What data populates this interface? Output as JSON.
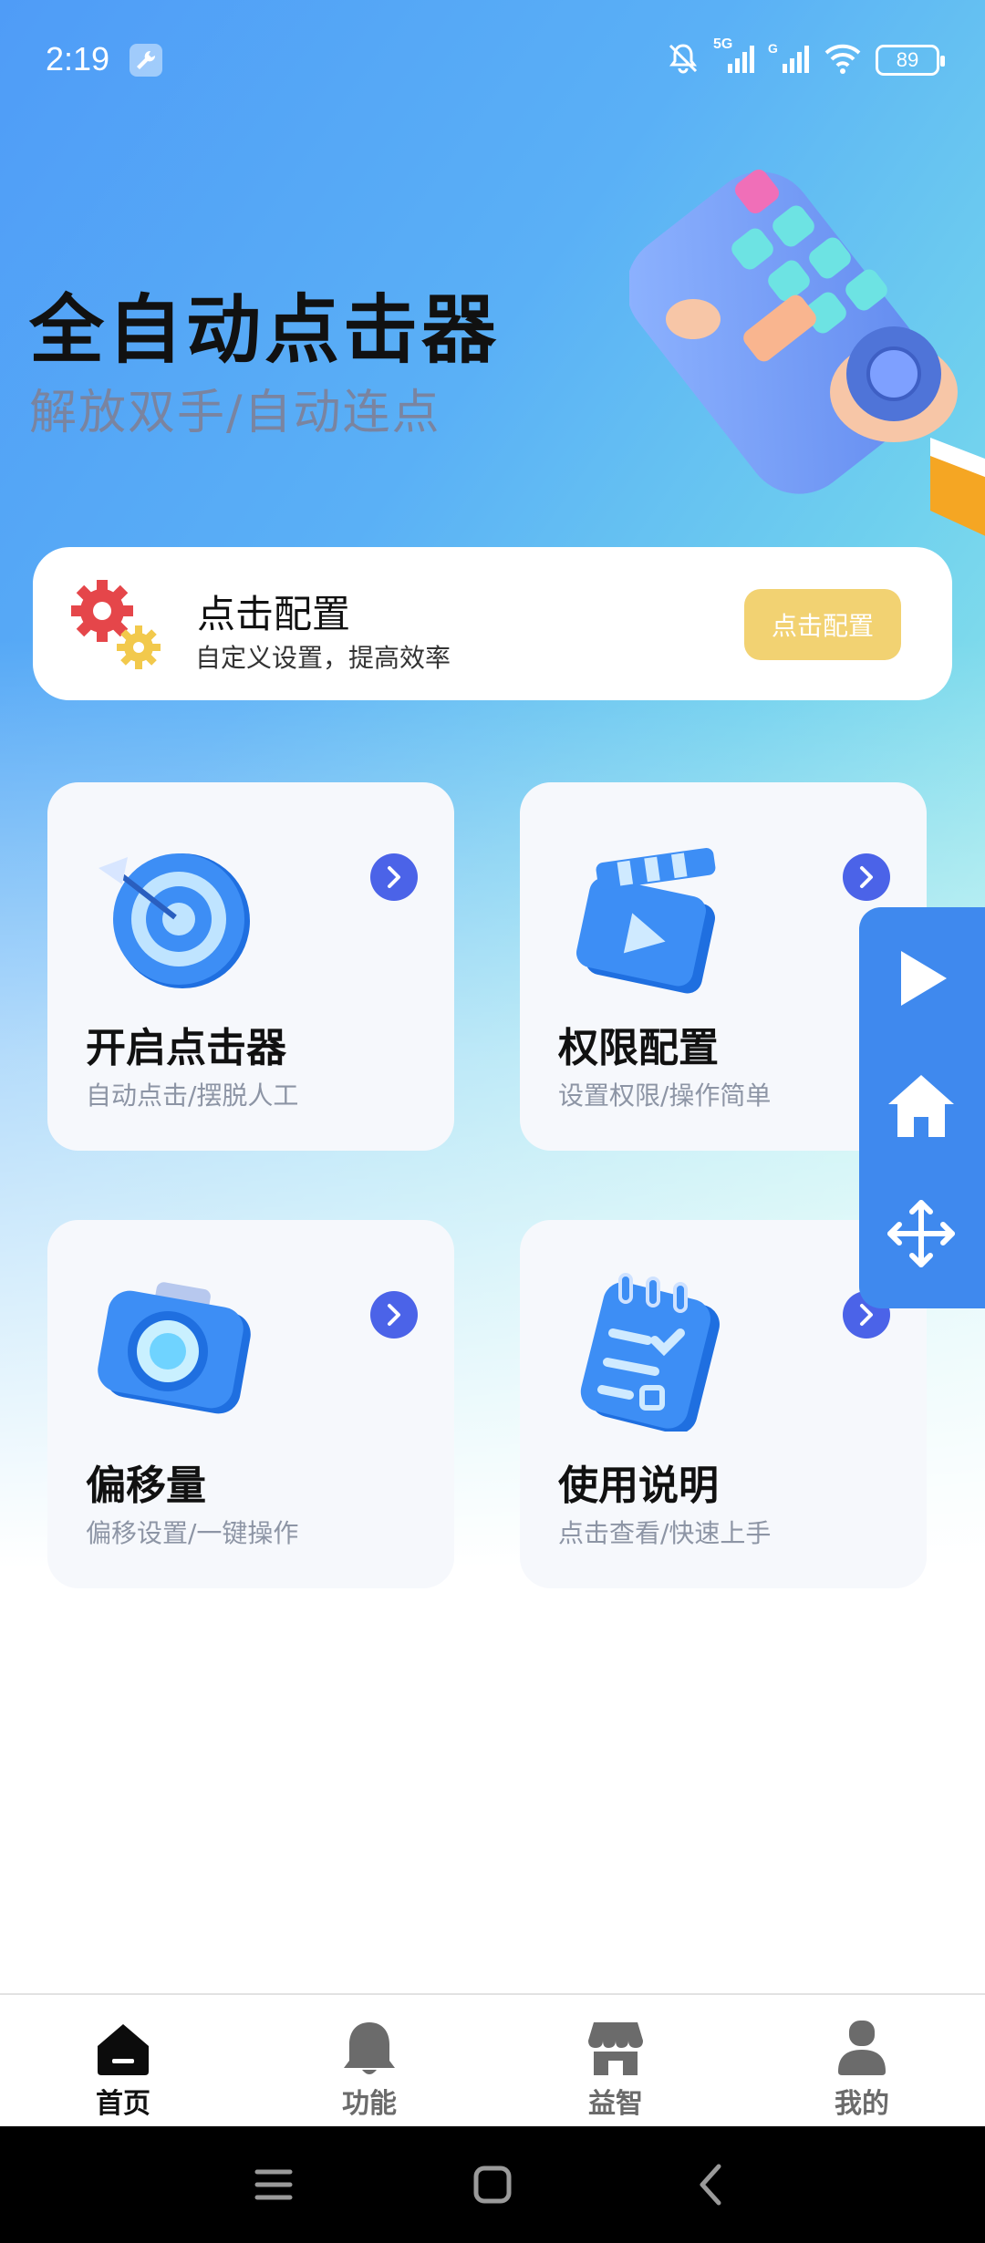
{
  "status_bar": {
    "time": "2:19",
    "battery": "89",
    "network_label": "5G"
  },
  "hero": {
    "title": "全自动点击器",
    "subtitle": "解放双手/自动连点"
  },
  "config_card": {
    "title": "点击配置",
    "subtitle": "自定义设置，提高效率",
    "button_label": "点击配置"
  },
  "features": [
    {
      "title": "开启点击器",
      "subtitle": "自动点击/摆脱人工",
      "icon": "target-icon"
    },
    {
      "title": "权限配置",
      "subtitle": "设置权限/操作简单",
      "icon": "clapperboard-icon"
    },
    {
      "title": "偏移量",
      "subtitle": "偏移设置/一键操作",
      "icon": "camera-icon"
    },
    {
      "title": "使用说明",
      "subtitle": "点击查看/快速上手",
      "icon": "checklist-icon"
    }
  ],
  "floating_panel": {
    "items": [
      "play-icon",
      "home-icon",
      "move-icon"
    ]
  },
  "bottom_nav": {
    "items": [
      {
        "label": "首页",
        "icon": "home-tab-icon",
        "active": true
      },
      {
        "label": "功能",
        "icon": "bell-icon",
        "active": false
      },
      {
        "label": "益智",
        "icon": "store-icon",
        "active": false
      },
      {
        "label": "我的",
        "icon": "user-icon",
        "active": false
      }
    ]
  },
  "colors": {
    "accent": "#4b63e8",
    "config_button": "#f2d272",
    "float_panel": "#3f89ee"
  }
}
